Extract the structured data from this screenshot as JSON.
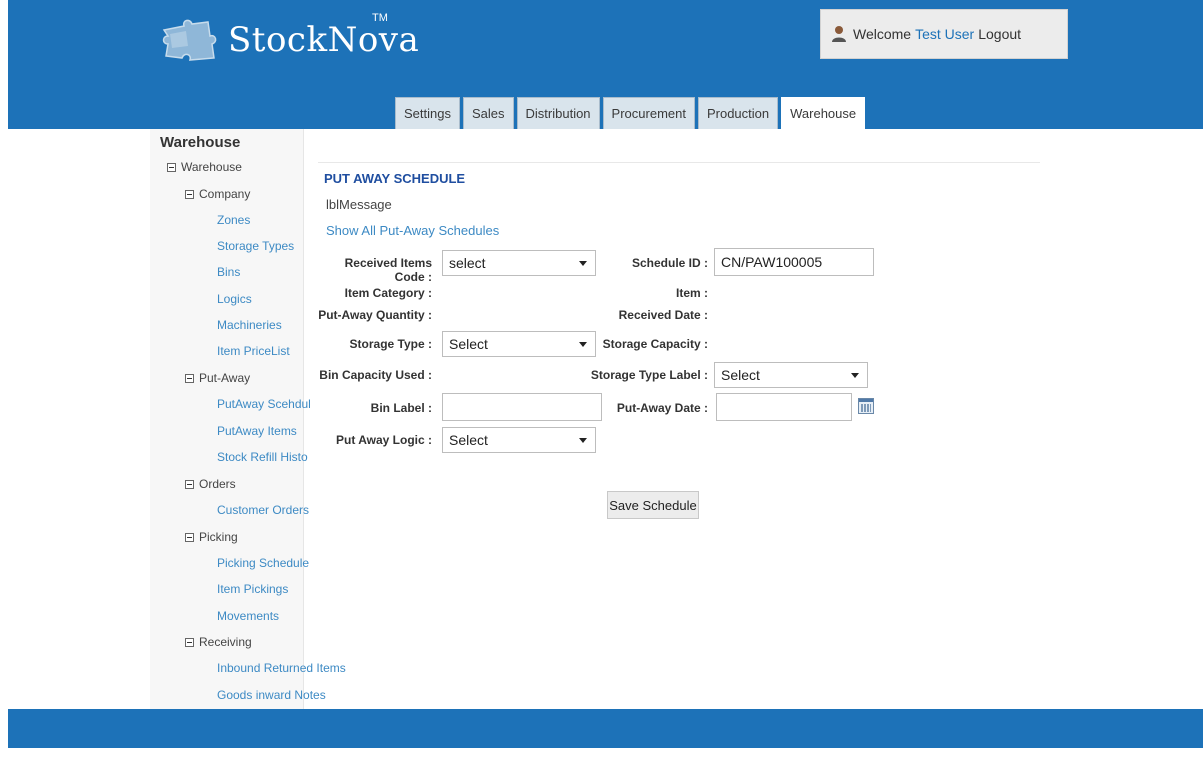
{
  "header": {
    "brand": "StockNova",
    "tm": "TM",
    "welcome_prefix": "Welcome",
    "user_name": "Test User",
    "logout": "Logout",
    "bg_color": "#1d72b8"
  },
  "tabs": [
    {
      "label": "Settings"
    },
    {
      "label": "Sales"
    },
    {
      "label": "Distribution"
    },
    {
      "label": "Procurement"
    },
    {
      "label": "Production"
    },
    {
      "label": "Warehouse",
      "active": true
    }
  ],
  "sidebar": {
    "title": "Warehouse",
    "root": "Warehouse",
    "company": {
      "label": "Company",
      "items": [
        "Zones",
        "Storage Types",
        "Bins",
        "Logics",
        "Machineries",
        "Item PriceList"
      ]
    },
    "putaway": {
      "label": "Put-Away",
      "items": [
        "PutAway Scehdul",
        "PutAway Items",
        "Stock Refill Histo"
      ]
    },
    "orders": {
      "label": "Orders",
      "items": [
        "Customer Orders"
      ]
    },
    "picking": {
      "label": "Picking",
      "items": [
        "Picking Schedule",
        "Item Pickings",
        "Movements"
      ]
    },
    "receiving": {
      "label": "Receiving",
      "items": [
        "Inbound Returned Items",
        "Goods inward Notes"
      ]
    }
  },
  "main": {
    "title": "PUT AWAY SCHEDULE",
    "message": "lblMessage",
    "show_all": "Show All Put-Away Schedules",
    "save_button": "Save Schedule"
  },
  "form": {
    "received_items_code": {
      "label": "Received Items Code :",
      "value": "select"
    },
    "schedule_id": {
      "label": "Schedule ID :",
      "value": "CN/PAW100005"
    },
    "item_category": {
      "label": "Item Category :"
    },
    "item": {
      "label": "Item :"
    },
    "put_away_quantity": {
      "label": "Put-Away Quantity :"
    },
    "received_date": {
      "label": "Received Date :"
    },
    "storage_type": {
      "label": "Storage Type :",
      "value": "Select"
    },
    "storage_capacity": {
      "label": "Storage Capacity :"
    },
    "bin_capacity_used": {
      "label": "Bin Capacity Used :"
    },
    "storage_type_label": {
      "label": "Storage Type Label :",
      "value": "Select"
    },
    "bin_label": {
      "label": "Bin Label :",
      "value": ""
    },
    "put_away_date": {
      "label": "Put-Away Date :",
      "value": ""
    },
    "put_away_logic": {
      "label": "Put Away Logic :",
      "value": "Select"
    }
  }
}
